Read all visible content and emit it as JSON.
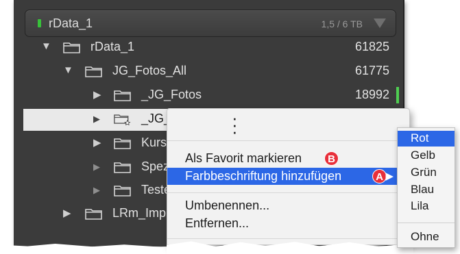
{
  "volume": {
    "name": "rData_1",
    "size": "1,5 / 6 TB",
    "status_color": "#38c23a"
  },
  "folders": [
    {
      "label": "rData_1",
      "count": "61825",
      "expander": "expanded"
    },
    {
      "label": "JG_Fotos_All",
      "count": "61775",
      "expander": "expanded"
    },
    {
      "label": "_JG_Fotos",
      "count": "18992",
      "expander": "collapsed"
    },
    {
      "label": "_JG_",
      "count": "",
      "expander": "collapsed-dim",
      "selected": true
    },
    {
      "label": "Kurs",
      "count": "",
      "expander": "collapsed"
    },
    {
      "label": "Spez",
      "count": "",
      "expander": "collapsed-dim"
    },
    {
      "label": "Teste",
      "count": "",
      "expander": "collapsed-dim"
    },
    {
      "label": "LRm_Imp",
      "count": "",
      "expander": "collapsed"
    }
  ],
  "context_menu": {
    "items": [
      {
        "label": "Als Favorit markieren",
        "badge": "B"
      },
      {
        "label": "Farbbeschriftung hinzufügen",
        "badge": "A"
      },
      {
        "label": "Umbenennen..."
      },
      {
        "label": "Entfernen..."
      }
    ]
  },
  "color_submenu": {
    "items": [
      "Rot",
      "Gelb",
      "Grün",
      "Blau",
      "Lila"
    ],
    "none_label": "Ohne",
    "selected": "Rot"
  },
  "colors": {
    "highlight": "#2c67e6",
    "badge": "#e8303b",
    "green_label": "#4fcf52"
  }
}
